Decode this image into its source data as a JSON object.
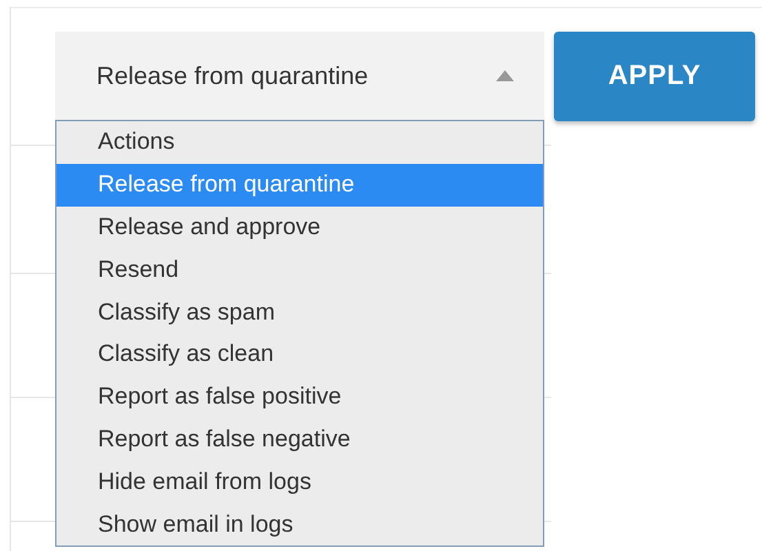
{
  "action_select": {
    "value": "Release from quarantine",
    "expanded": true,
    "options": [
      {
        "label": "Actions",
        "selected": false
      },
      {
        "label": "Release from quarantine",
        "selected": true
      },
      {
        "label": "Release and approve",
        "selected": false
      },
      {
        "label": "Resend",
        "selected": false
      },
      {
        "label": "Classify as spam",
        "selected": false
      },
      {
        "label": "Classify as clean",
        "selected": false
      },
      {
        "label": "Report as false positive",
        "selected": false
      },
      {
        "label": "Report as false negative",
        "selected": false
      },
      {
        "label": "Hide email from logs",
        "selected": false
      },
      {
        "label": "Show email in logs",
        "selected": false
      }
    ]
  },
  "apply_button": {
    "label": "APPLY"
  }
}
